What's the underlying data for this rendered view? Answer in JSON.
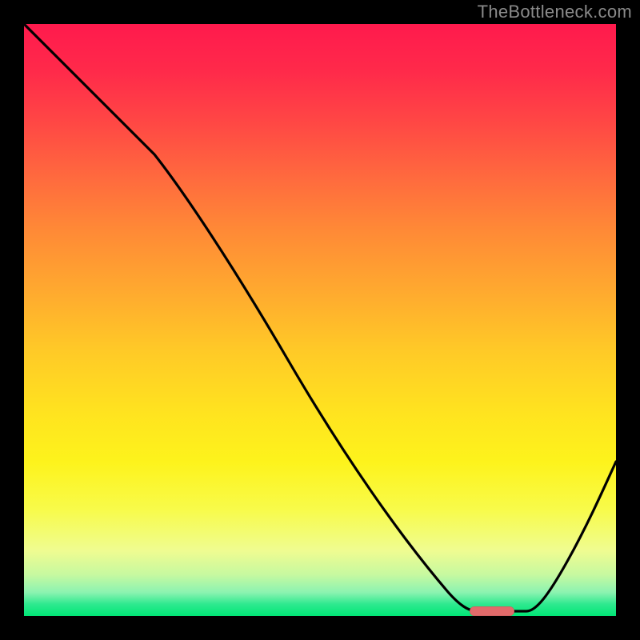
{
  "watermark": "TheBottleneck.com",
  "chart_data": {
    "type": "line",
    "title": "",
    "xlabel": "",
    "ylabel": "",
    "xlim": [
      0,
      100
    ],
    "ylim": [
      0,
      100
    ],
    "grid": false,
    "legend": false,
    "background": "red-yellow-green vertical gradient",
    "series": [
      {
        "name": "bottleneck-curve",
        "x": [
          0,
          10,
          22,
          35,
          48,
          60,
          71,
          74,
          80,
          86,
          92,
          100
        ],
        "y": [
          100,
          90,
          78,
          60,
          42,
          25,
          7,
          1,
          0,
          0,
          9,
          26
        ],
        "optimal_range_x": [
          76,
          83
        ],
        "optimal_y": 0.5
      }
    ],
    "marker": {
      "name": "optimal-marker",
      "x_center_pct": 79,
      "y_from_bottom_pct": 0.8,
      "color": "#e26b6b"
    },
    "colors": {
      "top": "#ff1a4d",
      "mid": "#ffe41f",
      "bottom": "#00e676",
      "curve": "#000000"
    }
  }
}
